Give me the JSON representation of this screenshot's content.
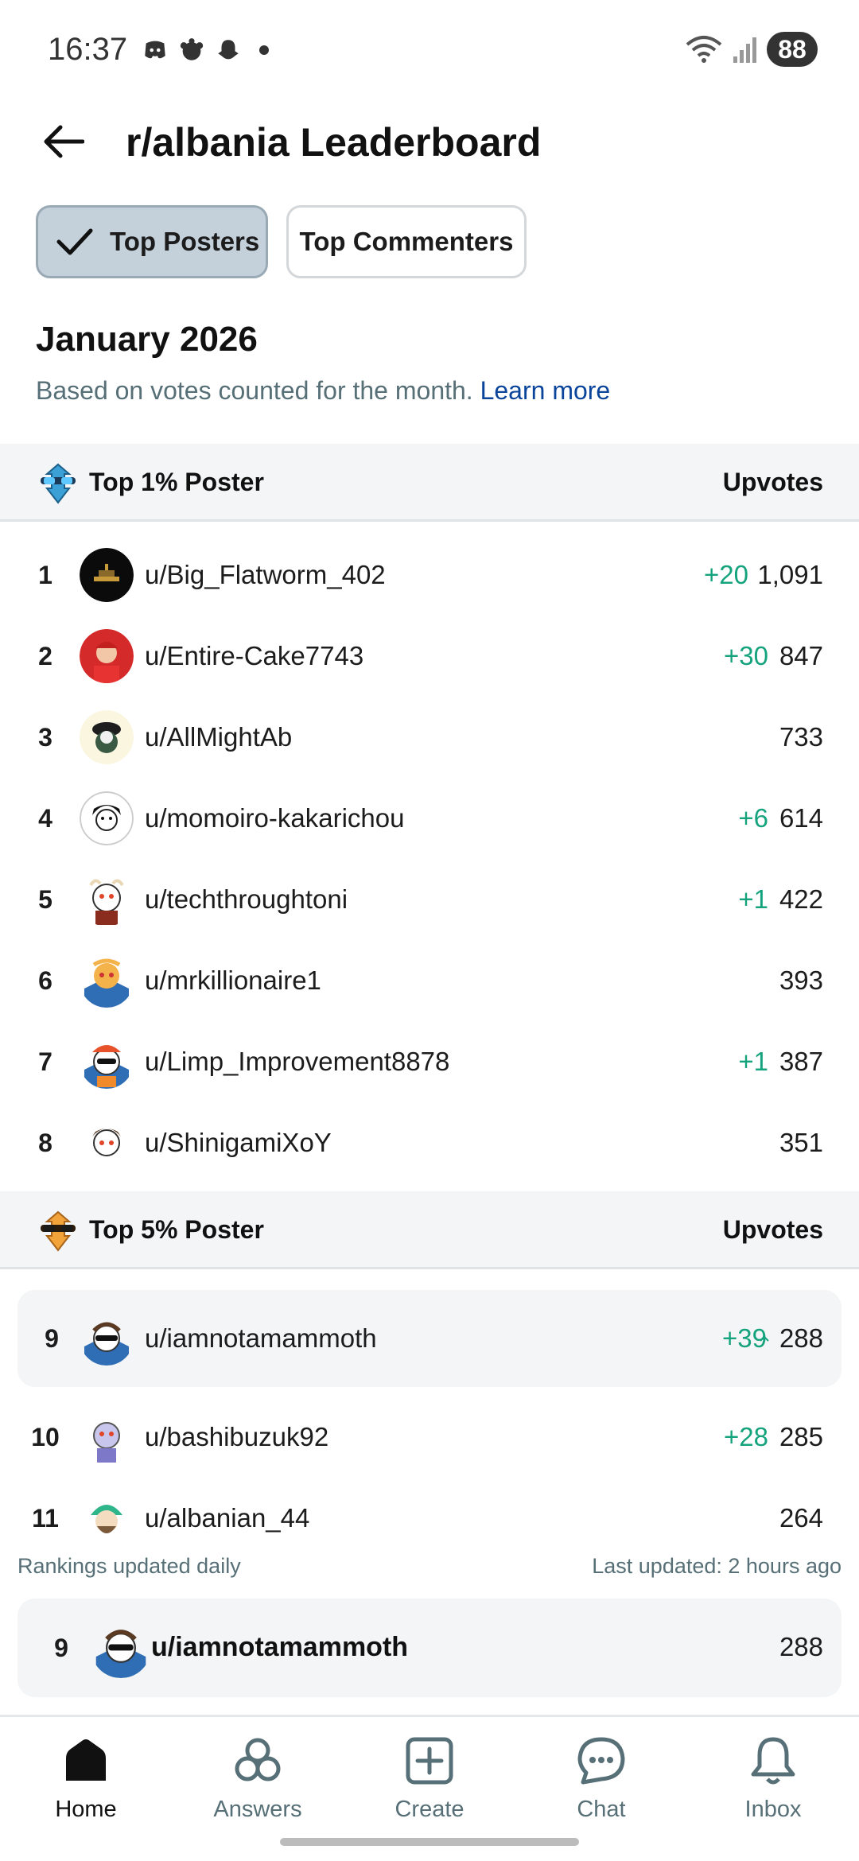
{
  "status_bar": {
    "time": "16:37",
    "battery": "88"
  },
  "header": {
    "title": "r/albania Leaderboard"
  },
  "tabs": [
    {
      "label": "Top Posters",
      "active": true
    },
    {
      "label": "Top Commenters",
      "active": false
    }
  ],
  "period": {
    "title": "January 2026",
    "subtitle": "Based on votes counted for the month.",
    "learn_more": "Learn more"
  },
  "sections": [
    {
      "label": "Top 1% Poster",
      "column": "Upvotes"
    },
    {
      "label": "Top 5% Poster",
      "column": "Upvotes"
    }
  ],
  "rows": [
    {
      "rank": "1",
      "user": "u/Big_Flatworm_402",
      "delta": "+20",
      "upvotes": "1,091"
    },
    {
      "rank": "2",
      "user": "u/Entire-Cake7743",
      "delta": "+30",
      "upvotes": "847"
    },
    {
      "rank": "3",
      "user": "u/AllMightAb",
      "delta": "",
      "upvotes": "733"
    },
    {
      "rank": "4",
      "user": "u/momoiro-kakarichou",
      "delta": "+6",
      "upvotes": "614"
    },
    {
      "rank": "5",
      "user": "u/techthroughtoni",
      "delta": "+1",
      "upvotes": "422"
    },
    {
      "rank": "6",
      "user": "u/mrkillionaire1",
      "delta": "",
      "upvotes": "393"
    },
    {
      "rank": "7",
      "user": "u/Limp_Improvement8878",
      "delta": "+1",
      "upvotes": "387"
    },
    {
      "rank": "8",
      "user": "u/ShinigamiXoY",
      "delta": "",
      "upvotes": "351"
    },
    {
      "rank": "9",
      "user": "u/iamnotamammoth",
      "delta": "+39",
      "upvotes": "288"
    },
    {
      "rank": "10",
      "user": "u/bashibuzuk92",
      "delta": "+28",
      "upvotes": "285"
    },
    {
      "rank": "11",
      "user": "u/albanian_44",
      "delta": "",
      "upvotes": "264"
    }
  ],
  "footer": {
    "left": "Rankings updated daily",
    "right": "Last updated: 2 hours ago"
  },
  "my_rank": {
    "rank": "9",
    "user": "u/iamnotamammoth",
    "upvotes": "288"
  },
  "nav": [
    {
      "label": "Home",
      "icon": "home-icon",
      "active": true
    },
    {
      "label": "Answers",
      "icon": "answers-icon",
      "active": false
    },
    {
      "label": "Create",
      "icon": "create-icon",
      "active": false
    },
    {
      "label": "Chat",
      "icon": "chat-icon",
      "active": false
    },
    {
      "label": "Inbox",
      "icon": "bell-icon",
      "active": false
    }
  ],
  "colors": {
    "upvote_green": "#15a37d",
    "link_blue": "#0a449b",
    "active_tab": "#c4d1da"
  }
}
